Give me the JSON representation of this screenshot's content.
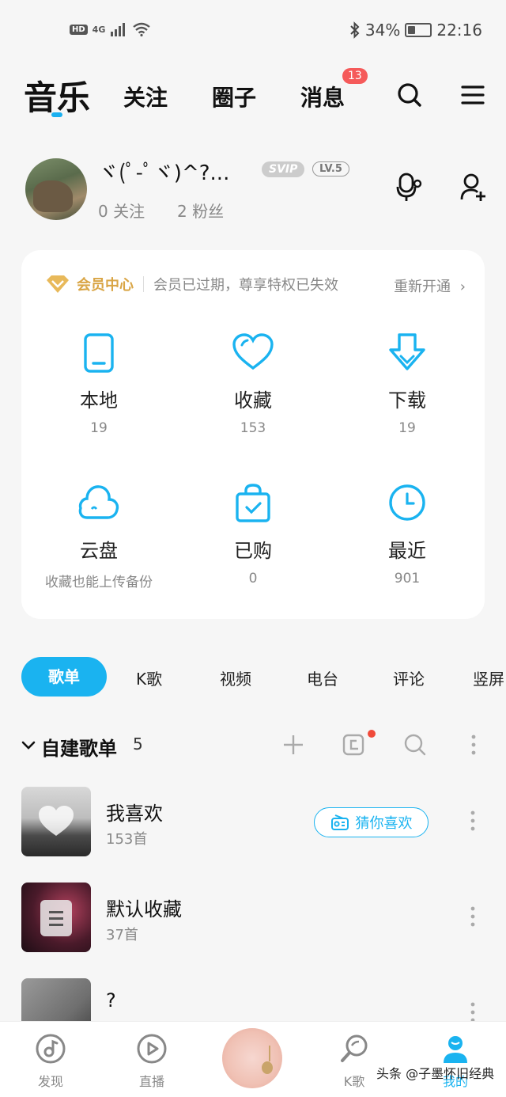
{
  "status_bar": {
    "network": "4G",
    "battery": "34%",
    "battery_level": 0.34,
    "time": "22:16"
  },
  "top_nav": {
    "music": "音乐",
    "follow": "关注",
    "circle": "圈子",
    "messages": "消息",
    "messages_badge": "13"
  },
  "profile": {
    "name": "ヾ(ﾟ-ﾟヾ)^?...",
    "svip": "SVIP",
    "level": "LV.5",
    "following": "0 关注",
    "fans": "2 粉丝"
  },
  "vip": {
    "title": "会员中心",
    "message": "会员已过期，尊享特权已失效",
    "renew": "重新开通"
  },
  "grid": [
    {
      "label": "本地",
      "sub": "19"
    },
    {
      "label": "收藏",
      "sub": "153"
    },
    {
      "label": "下载",
      "sub": "19"
    },
    {
      "label": "云盘",
      "sub": "收藏也能上传备份"
    },
    {
      "label": "已购",
      "sub": "0"
    },
    {
      "label": "最近",
      "sub": "901"
    }
  ],
  "tabs": [
    "歌单",
    "K歌",
    "视频",
    "电台",
    "评论",
    "竖屏"
  ],
  "section": {
    "title": "自建歌单",
    "count": "5"
  },
  "playlists": [
    {
      "title": "我喜欢",
      "sub": "153首",
      "action": "猜你喜欢"
    },
    {
      "title": "默认收藏",
      "sub": "37首"
    },
    {
      "title": "?",
      "sub": ""
    }
  ],
  "bottom_nav": {
    "discover": "发现",
    "live": "直播",
    "ksong": "K歌",
    "mine": "我的"
  },
  "watermark": "头条 @子墨怀旧经典",
  "colors": {
    "accent": "#1ab3f0",
    "vip_gold": "#d9a545",
    "badge_red": "#f55a5a"
  }
}
